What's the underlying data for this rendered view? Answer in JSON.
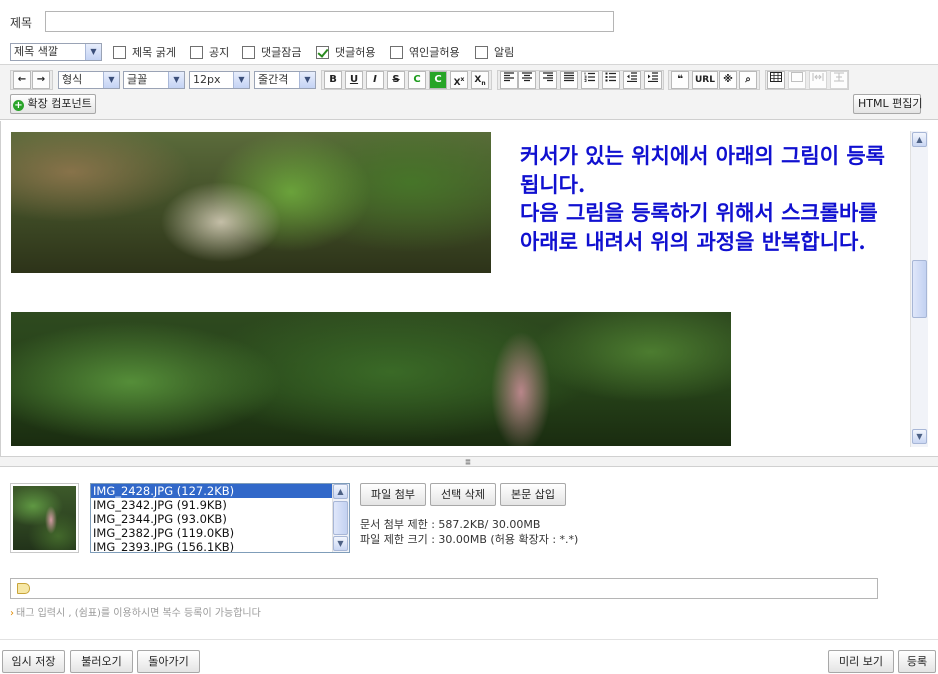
{
  "title_field": {
    "label": "제목",
    "value": ""
  },
  "options": {
    "title_color": "제목 색깔",
    "checkboxes": [
      {
        "label": "제목 굵게",
        "checked": false
      },
      {
        "label": "공지",
        "checked": false
      },
      {
        "label": "댓글잠금",
        "checked": false
      },
      {
        "label": "댓글허용",
        "checked": true
      },
      {
        "label": "엮인글허용",
        "checked": false
      },
      {
        "label": "알림",
        "checked": false
      }
    ]
  },
  "toolbar": {
    "format": "형식",
    "font": "글꼴",
    "size": "12px",
    "line_height": "줄간격",
    "undo": "←",
    "redo": "→",
    "bold": "B",
    "underline": "U",
    "italic": "I",
    "strike": "S",
    "text_color": "C",
    "bg_color": "C",
    "superscript": "X",
    "subscript": "X",
    "quote": "❝",
    "url": "URL",
    "special_char": "※",
    "find": "⌕",
    "extension_button": "확장 컴포넌트",
    "html_edit_button": "HTML 편집기"
  },
  "editor": {
    "text_lines": [
      "커서가 있는 위치에서 아래의 그림이 등록됩니다.",
      "다음 그림을 등록하기 위해서 스크롤바를 아래로 내려서 위의 과정을 반복합니다."
    ],
    "text_color": "#1010d0"
  },
  "attachments": {
    "files": [
      {
        "name": "IMG_2428.JPG (127.2KB)",
        "selected": true
      },
      {
        "name": "IMG_2342.JPG (91.9KB)",
        "selected": false
      },
      {
        "name": "IMG_2344.JPG (93.0KB)",
        "selected": false
      },
      {
        "name": "IMG_2382.JPG (119.0KB)",
        "selected": false
      },
      {
        "name": "IMG_2393.JPG (156.1KB)",
        "selected": false
      }
    ],
    "attach_button": "파일 첨부",
    "delete_button": "선택 삭제",
    "insert_button": "본문 삽입",
    "doc_limit": "문서 첨부 제한 : 587.2KB/ 30.00MB",
    "file_limit": "파일 제한 크기 : 30.00MB (허용 확장자 : *.*)"
  },
  "tags": {
    "value": "",
    "hint": "태그 입력시 , (쉼표)를 이용하시면 복수 등록이 가능합니다"
  },
  "footer": {
    "temp_save": "임시 저장",
    "load": "불러오기",
    "back": "돌아가기",
    "preview": "미리 보기",
    "submit": "등록"
  }
}
